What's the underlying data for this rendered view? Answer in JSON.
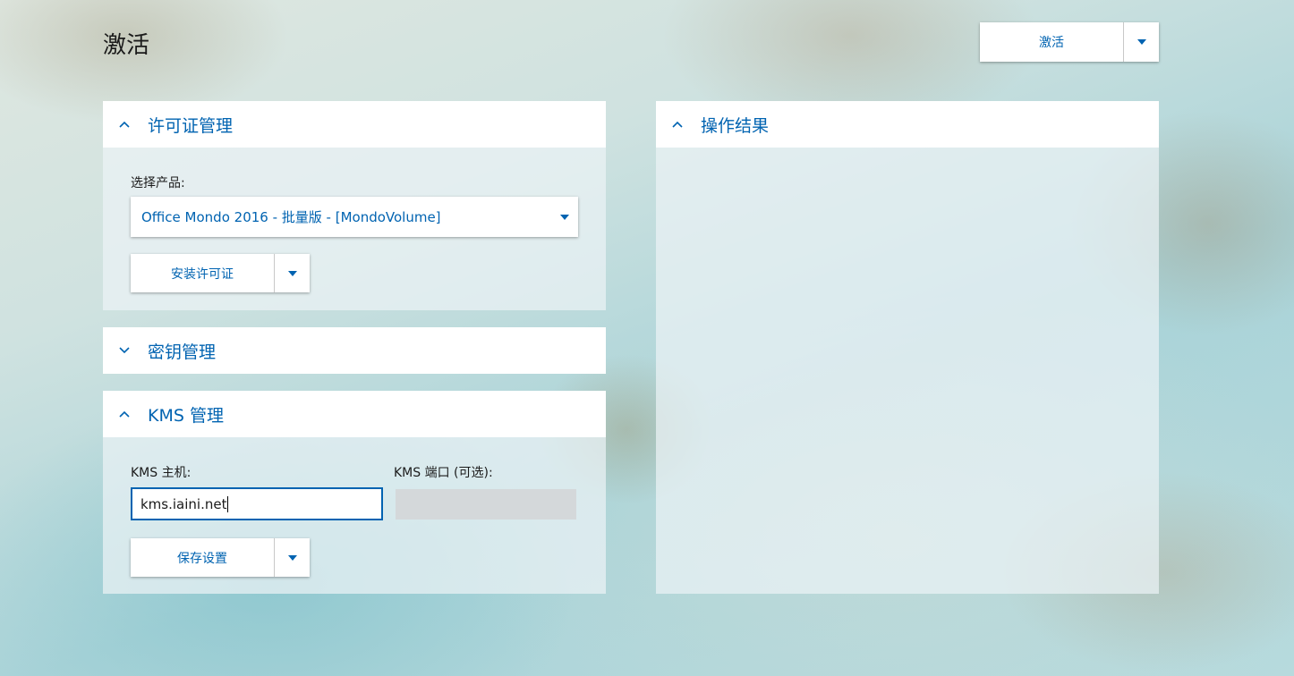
{
  "page_title": "激活",
  "activate_button": {
    "label": "激活"
  },
  "license_panel": {
    "title": "许可证管理",
    "select_label": "选择产品:",
    "selected_product": "Office Mondo 2016 - 批量版 - [MondoVolume]",
    "install_button": "安装许可证"
  },
  "key_panel": {
    "title": "密钥管理"
  },
  "kms_panel": {
    "title": "KMS 管理",
    "host_label": "KMS 主机:",
    "host_value": "kms.iaini.net",
    "port_label": "KMS 端口 (可选):",
    "port_value": "",
    "save_button": "保存设置"
  },
  "result_panel": {
    "title": "操作结果"
  },
  "colors": {
    "accent": "#0063b1",
    "panel_bg": "rgba(235,243,245,0.72)"
  }
}
